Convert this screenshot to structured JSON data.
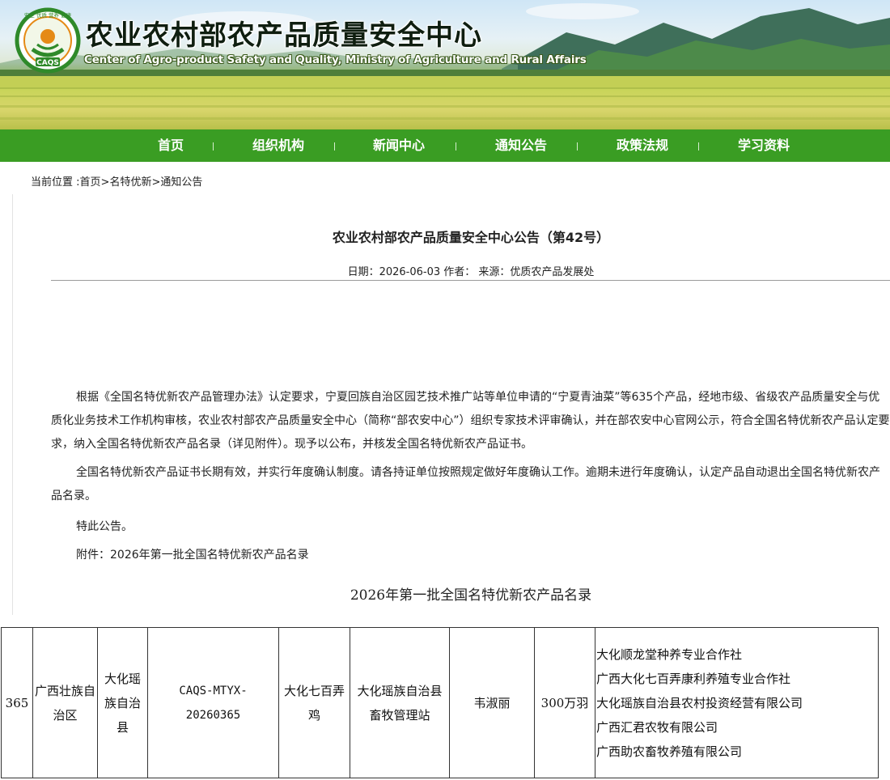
{
  "header": {
    "logo_text": "CAQS",
    "logo_ring_text": "安全 优质 营养 健康",
    "title": "农业农村部农产品质量安全中心",
    "subtitle": "Center of Agro-product Safety and Quality, Ministry of Agriculture and Rural Affairs"
  },
  "nav": {
    "items": [
      {
        "label": "首页"
      },
      {
        "label": "组织机构"
      },
      {
        "label": "新闻中心"
      },
      {
        "label": "通知公告"
      },
      {
        "label": "政策法规"
      },
      {
        "label": "学习资料"
      }
    ]
  },
  "breadcrumb": {
    "prefix": "当前位置 :",
    "home": "首页",
    "sep1": ">",
    "section": "名特优新",
    "sep2": ">",
    "page": "通知公告"
  },
  "article": {
    "title": "农业农村部农产品质量安全中心公告（第42号）",
    "meta": "日期：2026-06-03 作者： 来源：优质农产品发展处",
    "paragraphs": [
      "根据《全国名特优新农产品管理办法》认定要求，宁夏回族自治区园艺技术推广站等单位申请的“宁夏青油菜”等635个产品，经地市级、省级农产品质量安全与优质化业务技术工作机构审核，农业农村部农产品质量安全中心（简称“部农安中心”）组织专家技术评审确认，并在部农安中心官网公示，符合全国名特优新农产品认定要求，纳入全国名特优新农产品名录（详见附件）。现予以公布，并核发全国名特优新农产品证书。",
      "全国名特优新农产品证书长期有效，并实行年度确认制度。请各持证单位按照规定做好年度确认工作。逾期未进行年度确认，认定产品自动退出全国名特优新农产品名录。",
      "特此公告。",
      "附件：2026年第一批全国名特优新农产品名录"
    ],
    "list_title": "2026年第一批全国名特优新农产品名录"
  },
  "table": {
    "row": {
      "no": "365",
      "province": "广西壮族自治区",
      "county": "大化瑶族自治县",
      "cert_code_1": "CAQS-MTYX-",
      "cert_code_2": "20260365",
      "product": "大化七百弄鸡",
      "applicant": "大化瑶族自治县畜牧管理站",
      "expert": "韦淑丽",
      "scale": "300万羽",
      "holders": [
        "大化顺龙堂种养专业合作社",
        "广西大化七百弄康利养殖专业合作社",
        "大化瑶族自治县农村投资经营有限公司",
        "广西汇君农牧有限公司",
        "广西助农畜牧养殖有限公司"
      ]
    }
  },
  "colors": {
    "nav_green": "#3a9d23",
    "logo_green": "#2f8a2a",
    "logo_orange": "#e58a16"
  }
}
